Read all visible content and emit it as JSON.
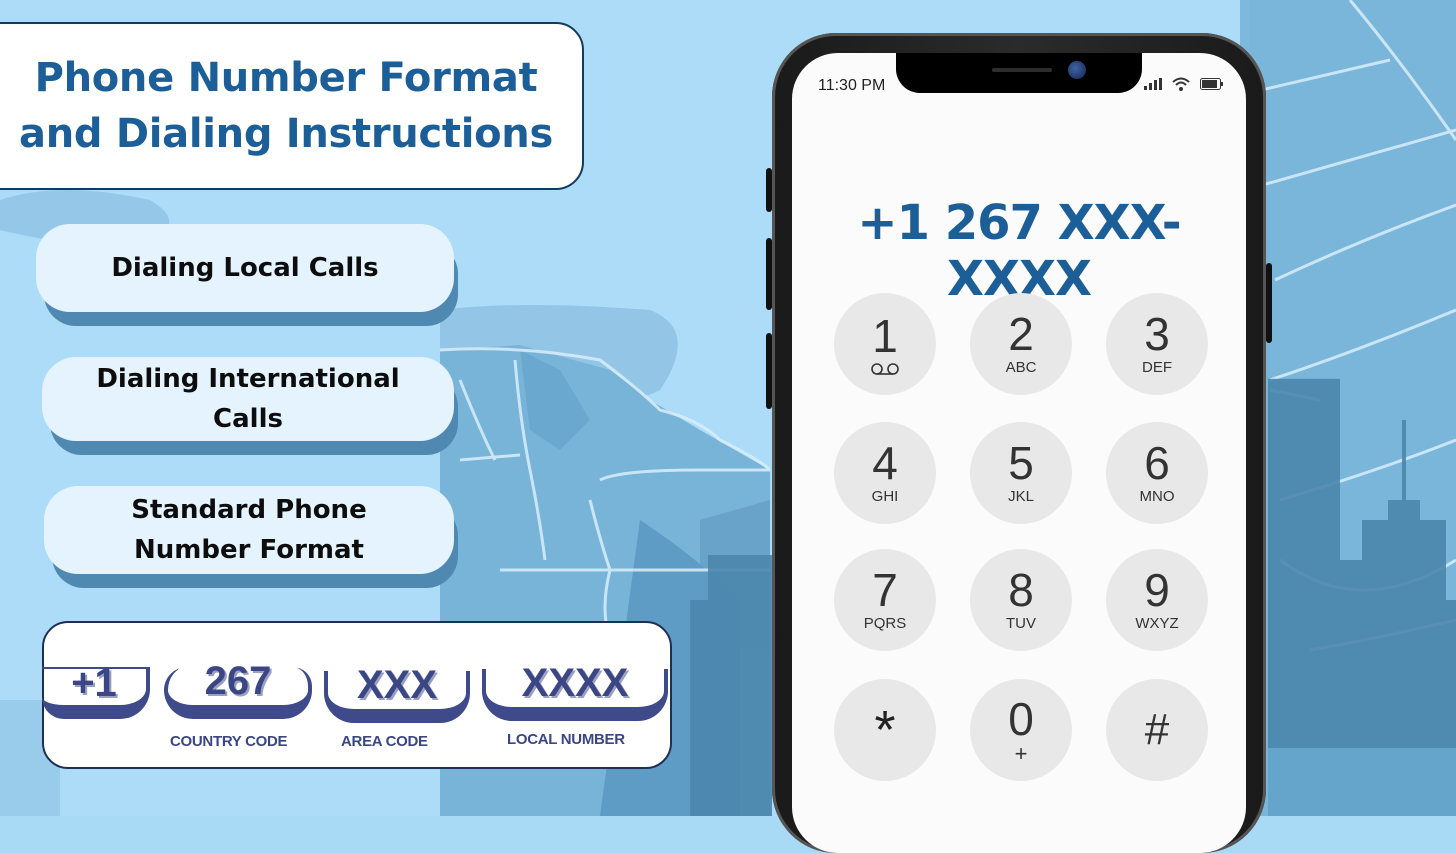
{
  "title": {
    "line1": "Phone Number Format",
    "line2": "and Dialing Instructions"
  },
  "menu": [
    {
      "lines": [
        "Dialing Local Calls"
      ]
    },
    {
      "lines": [
        "Dialing International",
        "Calls"
      ]
    },
    {
      "lines": [
        "Standard Phone",
        "Number Format"
      ]
    }
  ],
  "format": {
    "segments": [
      {
        "value": "+1",
        "label": ""
      },
      {
        "value": "267",
        "label": "COUNTRY CODE"
      },
      {
        "value": "XXX",
        "label": "AREA CODE"
      },
      {
        "value": "XXXX",
        "label": "LOCAL NUMBER"
      }
    ]
  },
  "phone": {
    "status_time": "11:30 PM",
    "status_icons": [
      "signal-icon",
      "wifi-icon",
      "battery-icon"
    ],
    "dialed_number": "+1 267 XXX-XXXX",
    "keys": [
      {
        "digit": "1",
        "letters": "voicemail-icon"
      },
      {
        "digit": "2",
        "letters": "ABC"
      },
      {
        "digit": "3",
        "letters": "DEF"
      },
      {
        "digit": "4",
        "letters": "GHI"
      },
      {
        "digit": "5",
        "letters": "JKL"
      },
      {
        "digit": "6",
        "letters": "MNO"
      },
      {
        "digit": "7",
        "letters": "PQRS"
      },
      {
        "digit": "8",
        "letters": "TUV"
      },
      {
        "digit": "9",
        "letters": "WXYZ"
      },
      {
        "digit": "*",
        "letters": ""
      },
      {
        "digit": "0",
        "letters": "+"
      },
      {
        "digit": "#",
        "letters": ""
      }
    ]
  },
  "colors": {
    "title_blue": "#1c5e97",
    "format_navy": "#3b4785",
    "background": "#a9daf5"
  }
}
